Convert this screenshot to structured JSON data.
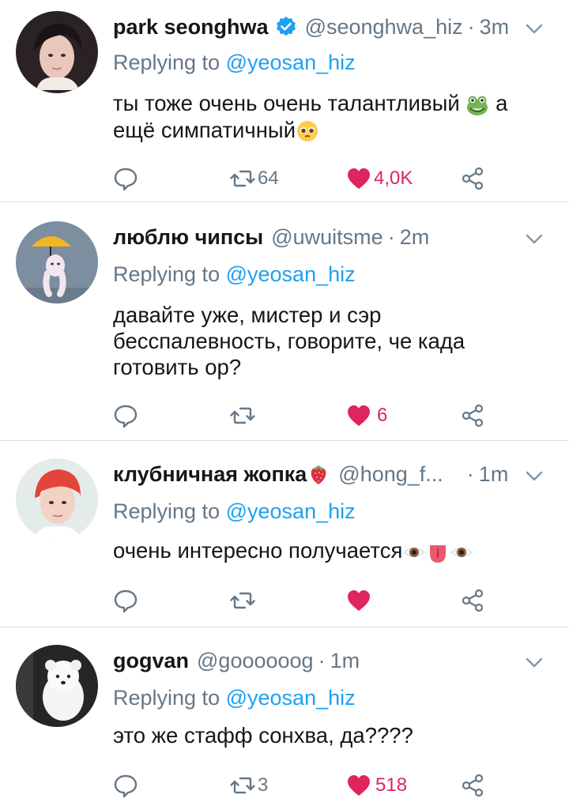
{
  "colors": {
    "accent": "#1da1f2",
    "like": "#e0245e",
    "muted": "#657786",
    "text": "#14171a",
    "divider": "#d9dee2"
  },
  "tweets": [
    {
      "name": "park seonghwa",
      "verified": true,
      "handle": "@seonghwa_hiz",
      "time": "3m",
      "reply_prefix": "Replying to",
      "reply_to": "@yeosan_hiz",
      "lines": [
        "ты тоже очень очень талантливый",
        "а",
        "ещё симпатичный"
      ],
      "emojis": [
        "frog-face",
        "pleading-face"
      ],
      "retweets": "64",
      "likes": "4,0K",
      "liked": true,
      "avatar": "young-man-portrait"
    },
    {
      "name": "люблю чипсы",
      "verified": false,
      "handle": "@uwuitsme",
      "time": "2m",
      "reply_prefix": "Replying to",
      "reply_to": "@yeosan_hiz",
      "lines": [
        "давайте уже, мистер и сэр",
        "бесспалевность, говорите, че када",
        "готовить ор?"
      ],
      "retweets": "",
      "likes": "6",
      "liked": true,
      "avatar": "cartoon-umbrella-character"
    },
    {
      "name": "клубничная жопка",
      "verified": false,
      "handle": "@hong_f...",
      "time": "1m",
      "reply_prefix": "Replying to",
      "reply_to": "@yeosan_hiz",
      "lines": [
        "очень интересно получается"
      ],
      "emojis": [
        "strawberry",
        "eye",
        "tongue",
        "eye"
      ],
      "retweets": "",
      "likes": "",
      "liked": true,
      "avatar": "red-haired-man-portrait"
    },
    {
      "name": "gogvan",
      "verified": false,
      "handle": "@goooooog",
      "time": "1m",
      "reply_prefix": "Replying to",
      "reply_to": "@yeosan_hiz",
      "lines": [
        "это же стафф сонхва, да????"
      ],
      "retweets": "3",
      "likes": "518",
      "liked": true,
      "avatar": "white-dog-photo"
    }
  ]
}
